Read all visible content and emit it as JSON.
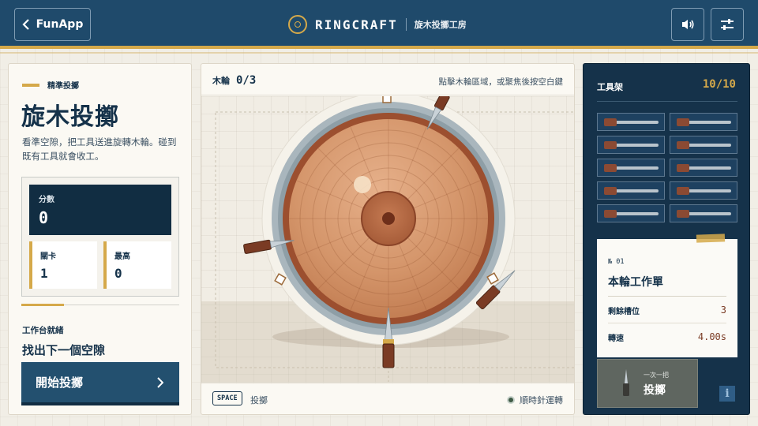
{
  "header": {
    "back_label": "FunApp",
    "brand_name": "RINGCRAFT",
    "brand_subtitle": "旋木投擲工房"
  },
  "left": {
    "eyebrow": "精準投擲",
    "title": "旋木投擲",
    "description": "看準空隙，把工具送進旋轉木輪。碰到既有工具就會收工。",
    "score_label": "分數",
    "score_value": "0",
    "level_label": "關卡",
    "level_value": "1",
    "best_label": "最高",
    "best_value": "0",
    "status_label": "工作台就緒",
    "status_hint": "找出下一個空隙",
    "start_label": "開始投擲"
  },
  "center": {
    "wheel_label": "木輪",
    "wheel_progress": "0/3",
    "hint": "點擊木輪區域，或聚焦後按空白鍵",
    "key_label": "SPACE",
    "key_action": "投擲",
    "rotation": "順時針運轉"
  },
  "right": {
    "rack_title": "工具架",
    "rack_count": "10/10",
    "tools_remaining": 10,
    "ticket_no": "№ 01",
    "ticket_title": "本輪工作單",
    "remaining_label": "剩餘槽位",
    "remaining_value": "3",
    "speed_label": "轉速",
    "speed_value": "4.00s",
    "throw_sub": "一次一把",
    "throw_main": "投擲",
    "info_label": "i"
  },
  "colors": {
    "navy": "#15324a",
    "header_blue": "#1f4a6b",
    "gold": "#d5a94a",
    "wood": "#d4956a",
    "wood_rim": "#9c4f2f"
  }
}
